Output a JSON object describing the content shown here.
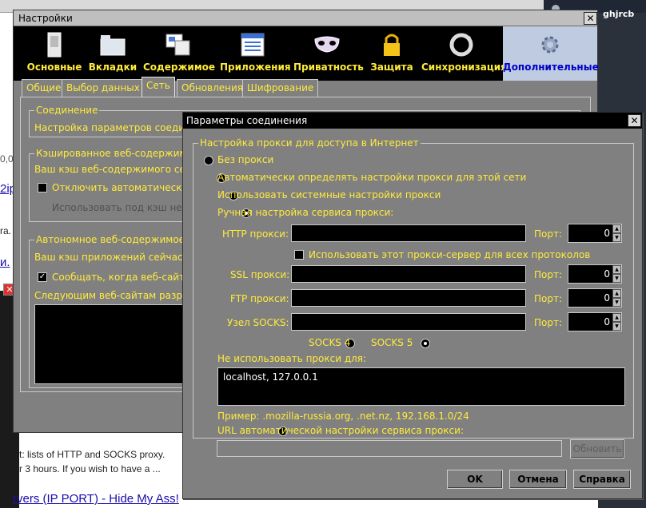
{
  "background": {
    "user_name": "ghjrcb",
    "fragments": [
      "0,0",
      "2ip",
      "ra.",
      "и."
    ],
    "snippet_line1": "t: lists of HTTP and SOCKS proxy.",
    "snippet_line2": "r 3 hours. If you wish to have a ...",
    "result_link": "rvers (IP PORT) - Hide My Ass!"
  },
  "settings": {
    "title": "Настройки",
    "toolbar": [
      {
        "label": "Основные",
        "icon": "switch-icon"
      },
      {
        "label": "Вкладки",
        "icon": "folder-tabs-icon"
      },
      {
        "label": "Содержимое",
        "icon": "content-icon"
      },
      {
        "label": "Приложения",
        "icon": "applications-icon"
      },
      {
        "label": "Приватность",
        "icon": "mask-icon"
      },
      {
        "label": "Защита",
        "icon": "lock-icon"
      },
      {
        "label": "Синхронизация",
        "icon": "sync-icon"
      },
      {
        "label": "Дополнительные",
        "icon": "gear-icon"
      }
    ],
    "tabs": [
      "Общие",
      "Выбор данных",
      "Сеть",
      "Обновления",
      "Шифрование"
    ],
    "connection_group": "Соединение",
    "connection_text": "Настройка параметров соедин",
    "cache_group": "Кэшированное веб-содержимо",
    "cache_text": "Ваш кэш веб-содержимого сей",
    "cache_checkbox": "Отключить автоматическо",
    "cache_dim": "Использовать под кэш не б",
    "offline_group": "Автономное веб-содержимое и",
    "offline_text": "Ваш кэш приложений сейчас за",
    "offline_checkbox": "Сообщать, когда веб-сайт",
    "offline_sites": "Следующим веб-сайтам разре"
  },
  "dialog": {
    "title": "Параметры соединения",
    "group_label": "Настройка прокси для доступа в Интернет",
    "options": [
      {
        "label": "Без прокси",
        "selected": false
      },
      {
        "label": "Автоматически определять настройки прокси для этой сети",
        "selected": false
      },
      {
        "label": "Использовать системные настройки прокси",
        "selected": false
      },
      {
        "label": "Ручная настройка сервиса прокси:",
        "selected": true
      }
    ],
    "http_label": "HTTP прокси:",
    "port_label": "Порт:",
    "http_port": "0",
    "same_proxy_label": "Использовать этот прокси-сервер для всех протоколов",
    "ssl_label": "SSL прокси:",
    "ssl_port": "0",
    "ftp_label": "FTP прокси:",
    "ftp_port": "0",
    "socks_label": "Узел SOCKS:",
    "socks_port": "0",
    "socks4": "SOCKS 4",
    "socks5": "SOCKS 5",
    "no_proxy_label": "Не использовать прокси для:",
    "no_proxy_value": "localhost, 127.0.0.1",
    "example": "Пример: .mozilla-russia.org, .net.nz, 192.168.1.0/24",
    "auto_url_label": "URL автоматической настройки сервиса прокси:",
    "reload_button": "Обновить",
    "ok": "OK",
    "cancel": "Отмена",
    "help": "Справка"
  },
  "colors": {
    "label_yellow": "#ffeb3b",
    "panel_grey": "#808080",
    "title_black": "#000000"
  }
}
